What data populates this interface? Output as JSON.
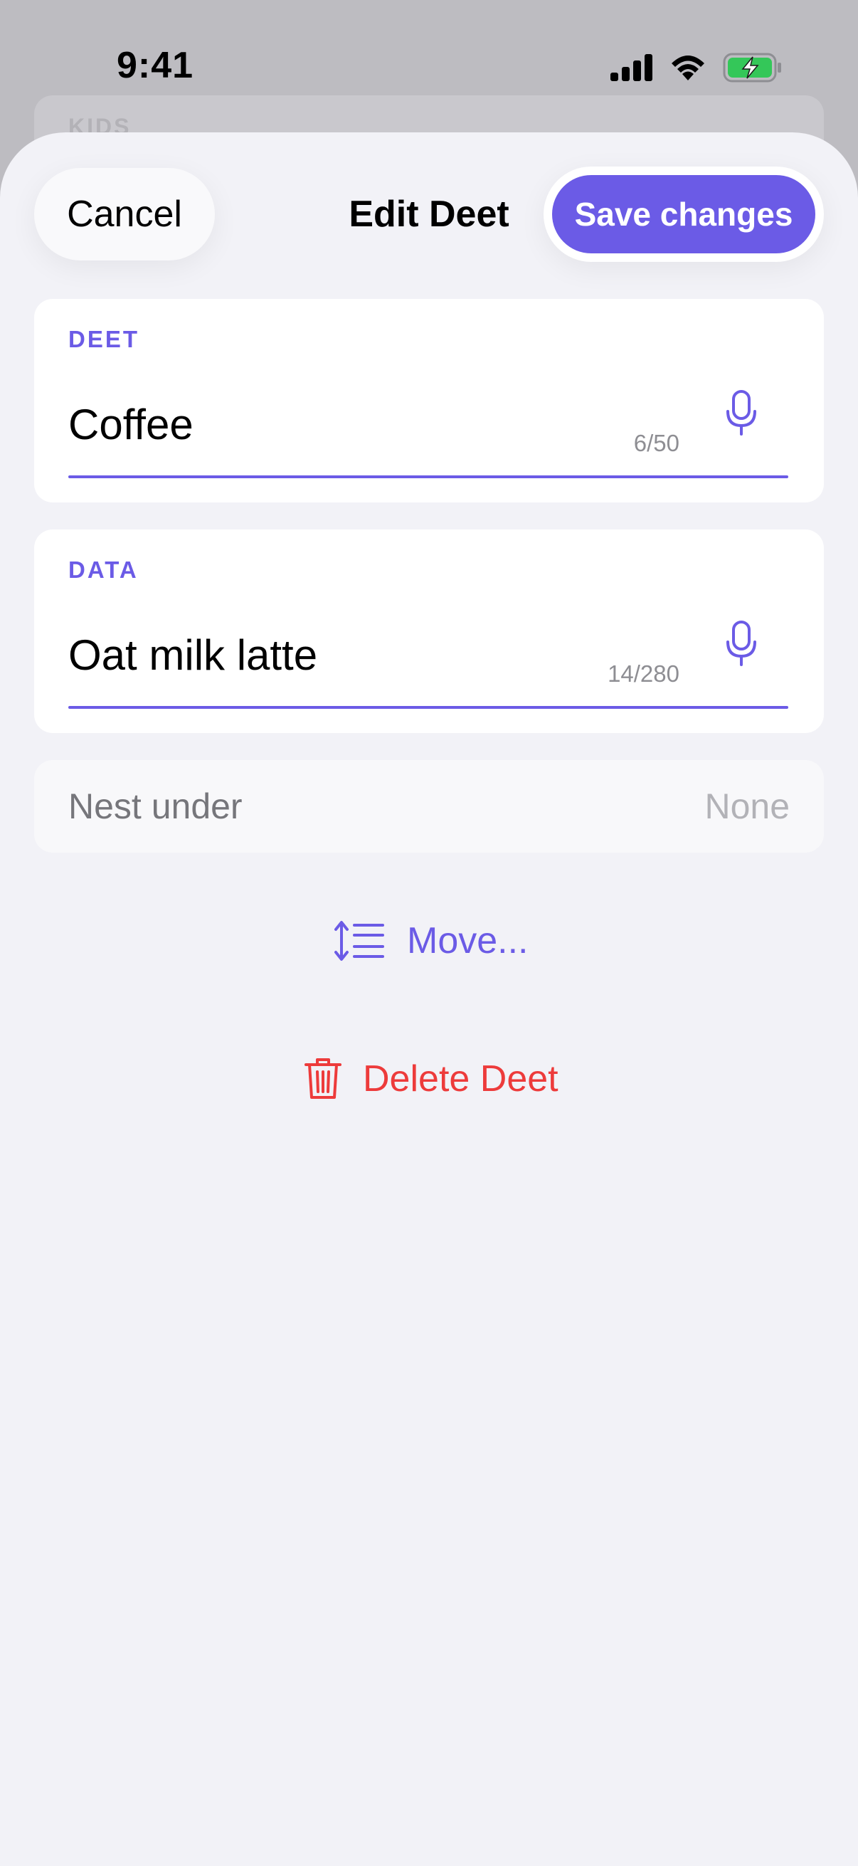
{
  "status_bar": {
    "time": "9:41",
    "icons": [
      "cellular-signal-icon",
      "wifi-icon",
      "battery-charging-icon"
    ]
  },
  "background_section": {
    "label": "KIDS"
  },
  "sheet": {
    "cancel_label": "Cancel",
    "title": "Edit Deet",
    "save_label": "Save changes"
  },
  "deet_field": {
    "label": "DEET",
    "value": "Coffee",
    "counter": "6/50",
    "icon": "microphone-icon"
  },
  "data_field": {
    "label": "DATA",
    "value": "Oat milk latte",
    "counter": "14/280",
    "icon": "microphone-icon"
  },
  "nest_under": {
    "label": "Nest under",
    "value": "None"
  },
  "move": {
    "label": "Move...",
    "icon": "reorder-list-icon"
  },
  "delete": {
    "label": "Delete Deet",
    "icon": "trash-icon"
  },
  "colors": {
    "accent": "#6b5be6",
    "destructive": "#ed3b3b",
    "sheet_background": "#f2f2f7",
    "battery_green": "#34c759"
  }
}
